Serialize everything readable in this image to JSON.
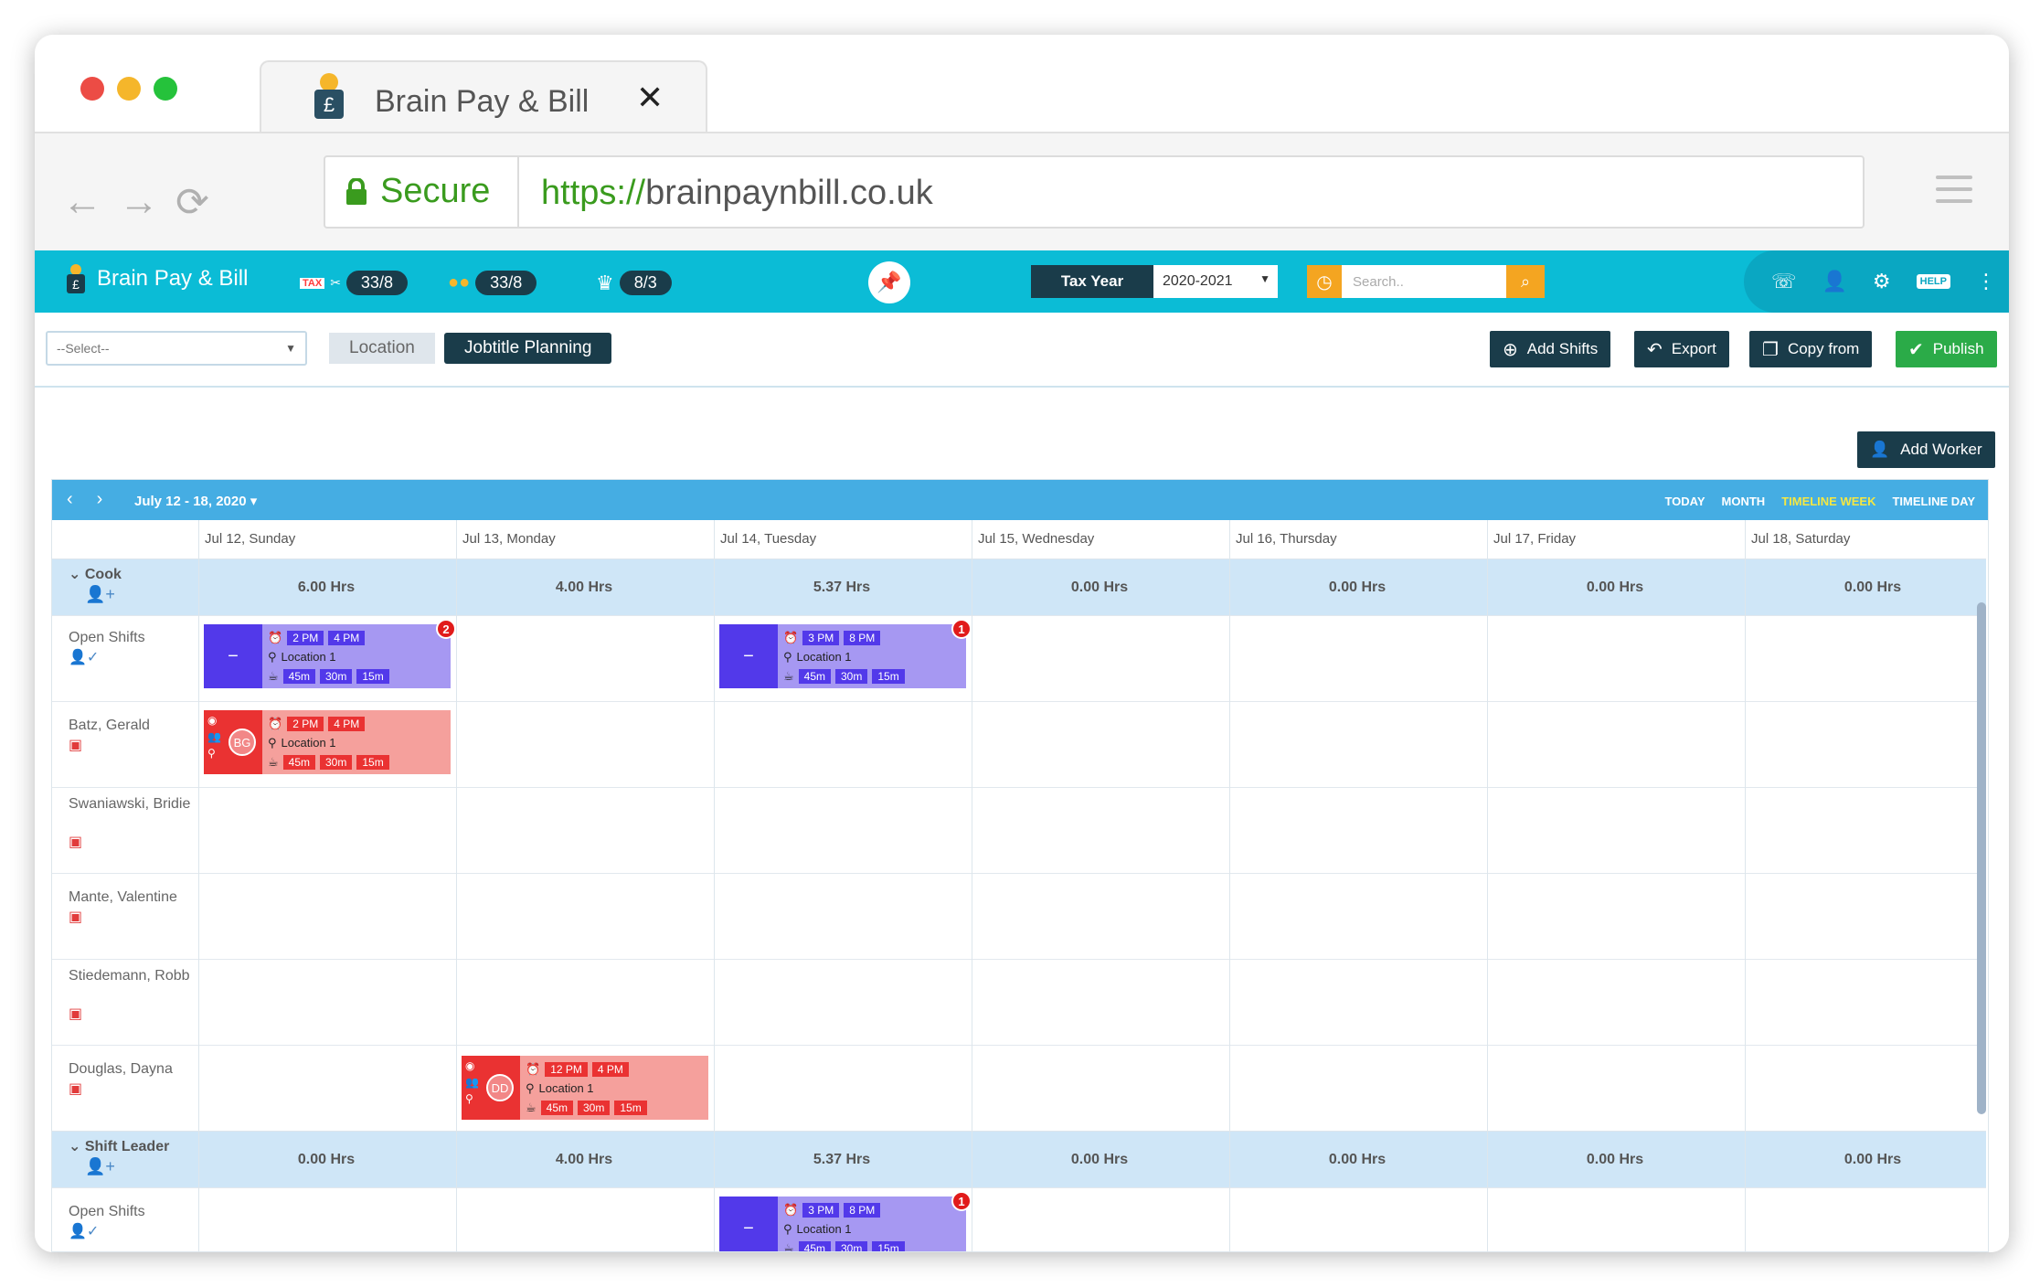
{
  "browser": {
    "tab_title": "Brain Pay & Bill",
    "tab_close": "✕",
    "secure_label": "Secure",
    "url_protocol": "https://",
    "url_host": "brainpaynbill.co.uk"
  },
  "header": {
    "brand": "Brain Pay & Bill",
    "stats": [
      {
        "icon": "tax-icon",
        "label": "TAX",
        "value": "33/8"
      },
      {
        "icon": "coins-icon",
        "label": "",
        "value": "33/8"
      },
      {
        "icon": "crown-icon",
        "label": "",
        "value": "8/3"
      }
    ],
    "tax_year_label": "Tax Year",
    "tax_year_value": "2020-2021",
    "search_placeholder": "Search..",
    "colors": {
      "primary": "#0bbcd6",
      "dark": "#1a3c4a",
      "accent": "#f4a521",
      "publish": "#2bab48"
    }
  },
  "toolbar": {
    "select_placeholder": "--Select--",
    "seg_location": "Location",
    "seg_jobtitle": "Jobtitle Planning",
    "add_shifts": "Add Shifts",
    "export": "Export",
    "copy_from": "Copy from",
    "publish": "Publish",
    "add_worker": "Add Worker"
  },
  "calendar": {
    "range": "July 12 - 18, 2020",
    "views": [
      "TODAY",
      "MONTH",
      "TIMELINE WEEK",
      "TIMELINE DAY"
    ],
    "active_view": "TIMELINE WEEK",
    "days": [
      "Jul 12, Sunday",
      "Jul 13, Monday",
      "Jul 14, Tuesday",
      "Jul 15, Wednesday",
      "Jul 16, Thursday",
      "Jul 17, Friday",
      "Jul 18, Saturday"
    ],
    "groups": [
      {
        "name": "Cook",
        "hours": [
          "6.00 Hrs",
          "4.00 Hrs",
          "5.37 Hrs",
          "0.00 Hrs",
          "0.00 Hrs",
          "0.00 Hrs",
          "0.00 Hrs"
        ],
        "rows": [
          "Open Shifts",
          "Batz, Gerald",
          "Swaniawski, Bridie",
          "Mante, Valentine",
          "Stiedemann, Robb",
          "Douglas, Dayna"
        ]
      },
      {
        "name": "Shift Leader",
        "hours": [
          "0.00 Hrs",
          "4.00 Hrs",
          "5.37 Hrs",
          "0.00 Hrs",
          "0.00 Hrs",
          "0.00 Hrs",
          "0.00 Hrs"
        ],
        "rows": [
          "Open Shifts"
        ]
      }
    ],
    "shifts": [
      {
        "kind": "open",
        "start": "2 PM",
        "end": "4 PM",
        "location": "Location 1",
        "breaks": [
          "45m",
          "30m",
          "15m"
        ],
        "count": "2",
        "initials": ""
      },
      {
        "kind": "open",
        "start": "3 PM",
        "end": "8 PM",
        "location": "Location 1",
        "breaks": [
          "45m",
          "30m",
          "15m"
        ],
        "count": "1",
        "initials": ""
      },
      {
        "kind": "assigned",
        "start": "2 PM",
        "end": "4 PM",
        "location": "Location 1",
        "breaks": [
          "45m",
          "30m",
          "15m"
        ],
        "count": "",
        "initials": "BG"
      },
      {
        "kind": "assigned",
        "start": "12 PM",
        "end": "4 PM",
        "location": "Location 1",
        "breaks": [
          "45m",
          "30m",
          "15m"
        ],
        "count": "",
        "initials": "DD"
      },
      {
        "kind": "open",
        "start": "3 PM",
        "end": "8 PM",
        "location": "Location 1",
        "breaks": [
          "45m",
          "30m",
          "15m"
        ],
        "count": "1",
        "initials": ""
      }
    ]
  }
}
